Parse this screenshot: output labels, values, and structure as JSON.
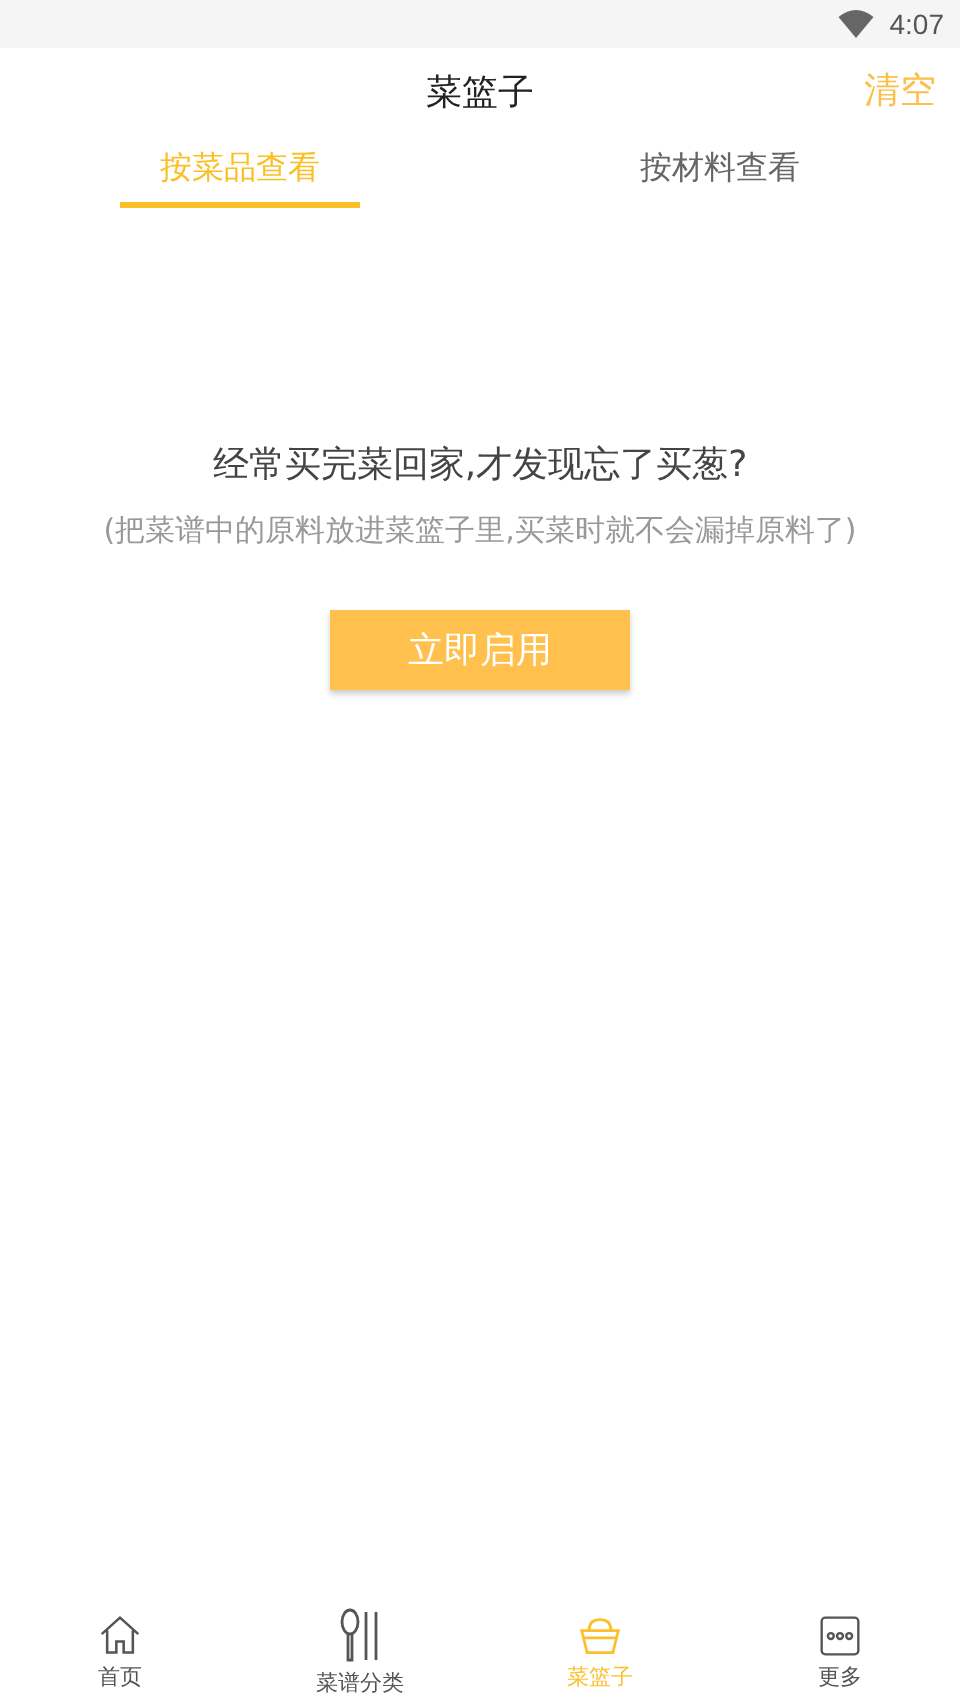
{
  "status_bar": {
    "time": "4:07"
  },
  "header": {
    "title": "菜篮子",
    "action": "清空"
  },
  "tabs": [
    {
      "label": "按菜品查看",
      "selected": true
    },
    {
      "label": "按材料查看",
      "selected": false
    }
  ],
  "empty_state": {
    "question": "经常买完菜回家,才发现忘了买葱?",
    "hint": "(把菜谱中的原料放进菜篮子里,买菜时就不会漏掉原料了)",
    "button": "立即启用"
  },
  "bottom_nav": [
    {
      "kind": "home",
      "label": "首页",
      "selected": false
    },
    {
      "kind": "recipes",
      "label": "菜谱分类",
      "selected": false
    },
    {
      "kind": "basket",
      "label": "菜篮子",
      "selected": true
    },
    {
      "kind": "more",
      "label": "更多",
      "selected": false
    }
  ]
}
